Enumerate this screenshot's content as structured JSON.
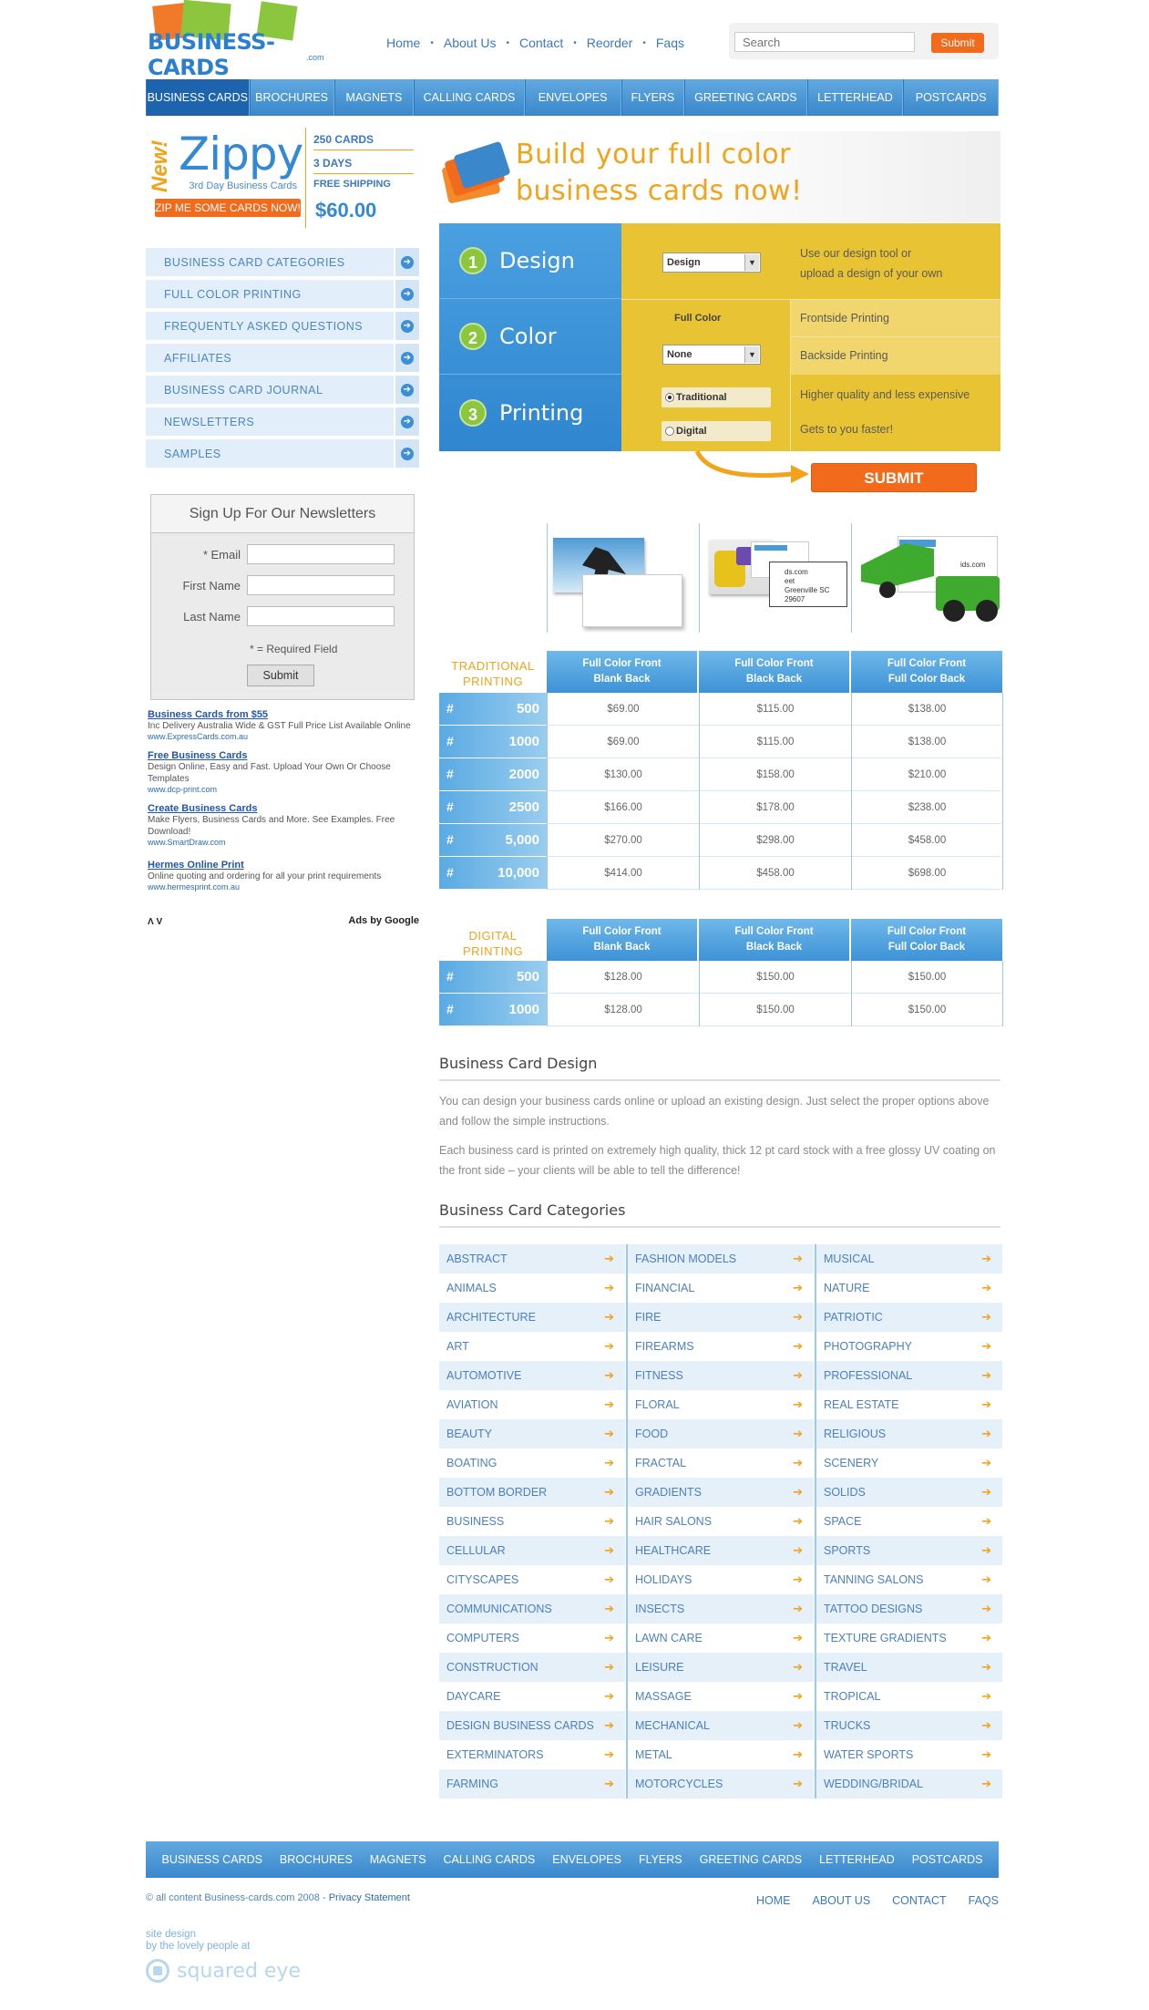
{
  "brand": {
    "logo_text": "BUSINESS-CARDS",
    "logo_domain": ".com"
  },
  "topnav": [
    "Home",
    "About Us",
    "Contact",
    "Reorder",
    "Faqs"
  ],
  "search": {
    "placeholder": "Search",
    "button": "Submit"
  },
  "main_menu": [
    "BUSINESS CARDS",
    "BROCHURES",
    "MAGNETS",
    "CALLING CARDS",
    "ENVELOPES",
    "FLYERS",
    "GREETING CARDS",
    "LETTERHEAD",
    "POSTCARDS"
  ],
  "promo": {
    "new": "New!",
    "name": "Zippy",
    "subtitle": "3rd Day Business Cards",
    "cta": "ZIP ME SOME CARDS NOW!",
    "features": [
      "250 CARDS",
      "3 DAYS",
      "FREE SHIPPING"
    ],
    "price": "$60.00"
  },
  "sidebar": [
    "BUSINESS CARD CATEGORIES",
    "FULL COLOR PRINTING",
    "FREQUENTLY ASKED QUESTIONS",
    "AFFILIATES",
    "BUSINESS CARD JOURNAL",
    "NEWSLETTERS",
    "SAMPLES"
  ],
  "newsletter": {
    "title": "Sign Up For Our Newsletters",
    "email_label": "* Email",
    "first_label": "First Name",
    "last_label": "Last Name",
    "required_note": "* = Required Field",
    "submit": "Submit"
  },
  "ads": [
    {
      "title": "Business Cards from $55",
      "desc": "Inc Delivery Australia Wide & GST Full Price List Available Online",
      "url": "www.ExpressCards.com.au"
    },
    {
      "title": "Free Business Cards",
      "desc": "Design Online, Easy and Fast. Upload Your Own Or Choose Templates",
      "url": "www.dcp-print.com"
    },
    {
      "title": "Create Business Cards",
      "desc": "Make Flyers, Business Cards and More. See Examples. Free Download!",
      "url": "www.SmartDraw.com"
    },
    {
      "title": "Hermes Online Print",
      "desc": "Online quoting and ordering for all your print requirements",
      "url": "www.hermesprint.com.au"
    }
  ],
  "ads_footer": {
    "nav": "Λ V",
    "by": "Ads by Google"
  },
  "hero": {
    "line1": "Build your full color",
    "line2": "business cards now!"
  },
  "builder": {
    "steps": [
      {
        "num": "1",
        "label": "Design"
      },
      {
        "num": "2",
        "label": "Color"
      },
      {
        "num": "3",
        "label": "Printing"
      }
    ],
    "design_select": "Design",
    "design_help": [
      "Use our design tool or",
      "upload a design of your own"
    ],
    "full_color": "Full Color",
    "color_select": "None",
    "frontside": "Frontside Printing",
    "backside": "Backside Printing",
    "traditional": "Traditional",
    "digital": "Digital",
    "traditional_help": "Higher quality and less expensive",
    "digital_help": "Gets to you faster!",
    "submit": "SUBMIT"
  },
  "traditional": {
    "label": [
      "TRADITIONAL",
      "PRINTING"
    ],
    "columns": [
      [
        "Full Color Front",
        "Blank Back"
      ],
      [
        "Full Color Front",
        "Black Back"
      ],
      [
        "Full Color Front",
        "Full Color Back"
      ]
    ],
    "sample_text": [
      "ds.com",
      "eet",
      "Greenville SC 29607",
      "ids.com"
    ],
    "rows": [
      {
        "qty": "500",
        "prices": [
          "$69.00",
          "$115.00",
          "$138.00"
        ]
      },
      {
        "qty": "1000",
        "prices": [
          "$69.00",
          "$115.00",
          "$138.00"
        ]
      },
      {
        "qty": "2000",
        "prices": [
          "$130.00",
          "$158.00",
          "$210.00"
        ]
      },
      {
        "qty": "2500",
        "prices": [
          "$166.00",
          "$178.00",
          "$238.00"
        ]
      },
      {
        "qty": "5,000",
        "prices": [
          "$270.00",
          "$298.00",
          "$458.00"
        ]
      },
      {
        "qty": "10,000",
        "prices": [
          "$414.00",
          "$458.00",
          "$698.00"
        ]
      }
    ]
  },
  "digital": {
    "label": [
      "DIGITAL",
      "PRINTING"
    ],
    "columns": [
      [
        "Full Color Front",
        "Blank Back"
      ],
      [
        "Full Color Front",
        "Black Back"
      ],
      [
        "Full Color Front",
        "Full Color Back"
      ]
    ],
    "rows": [
      {
        "qty": "500",
        "prices": [
          "$128.00",
          "$150.00",
          "$150.00"
        ]
      },
      {
        "qty": "1000",
        "prices": [
          "$128.00",
          "$150.00",
          "$150.00"
        ]
      }
    ]
  },
  "design_section": {
    "title": "Business Card Design",
    "p1": "You can design your business cards online or upload an existing design. Just select the proper options above and follow the simple instructions.",
    "p2": "Each business card is printed on extremely high quality, thick 12 pt card stock with a free glossy UV coating on the front side – your clients will be able to tell the difference!"
  },
  "categories_section": {
    "title": "Business Card Categories",
    "col1": [
      "ABSTRACT",
      "ANIMALS",
      "ARCHITECTURE",
      "ART",
      "AUTOMOTIVE",
      "AVIATION",
      "BEAUTY",
      "BOATING",
      "BOTTOM BORDER",
      "BUSINESS",
      "CELLULAR",
      "CITYSCAPES",
      "COMMUNICATIONS",
      "COMPUTERS",
      "CONSTRUCTION",
      "DAYCARE",
      "DESIGN BUSINESS CARDS",
      "EXTERMINATORS",
      "FARMING"
    ],
    "col2": [
      "FASHION MODELS",
      "FINANCIAL",
      "FIRE",
      "FIREARMS",
      "FITNESS",
      "FLORAL",
      "FOOD",
      "FRACTAL",
      "GRADIENTS",
      "HAIR SALONS",
      "HEALTHCARE",
      "HOLIDAYS",
      "INSECTS",
      "LAWN CARE",
      "LEISURE",
      "MASSAGE",
      "MECHANICAL",
      "METAL",
      "MOTORCYCLES"
    ],
    "col3": [
      "MUSICAL",
      "NATURE",
      "PATRIOTIC",
      "PHOTOGRAPHY",
      "PROFESSIONAL",
      "REAL ESTATE",
      "RELIGIOUS",
      "SCENERY",
      "SOLIDS",
      "SPACE",
      "SPORTS",
      "TANNING SALONS",
      "TATTOO DESIGNS",
      "TEXTURE GRADIENTS",
      "TRAVEL",
      "TROPICAL",
      "TRUCKS",
      "WATER SPORTS",
      "WEDDING/BRIDAL"
    ]
  },
  "footer": {
    "menu": [
      "BUSINESS CARDS",
      "BROCHURES",
      "MAGNETS",
      "CALLING CARDS",
      "ENVELOPES",
      "FLYERS",
      "GREETING CARDS",
      "LETTERHEAD",
      "POSTCARDS"
    ],
    "copyright": "© all content Business-cards.com 2008 - ",
    "privacy": "Privacy Statement",
    "links": [
      "HOME",
      "ABOUT US",
      "CONTACT",
      "FAQS"
    ],
    "credit1": "site design",
    "credit2": "by the lovely people at",
    "studio": "squared eye"
  }
}
